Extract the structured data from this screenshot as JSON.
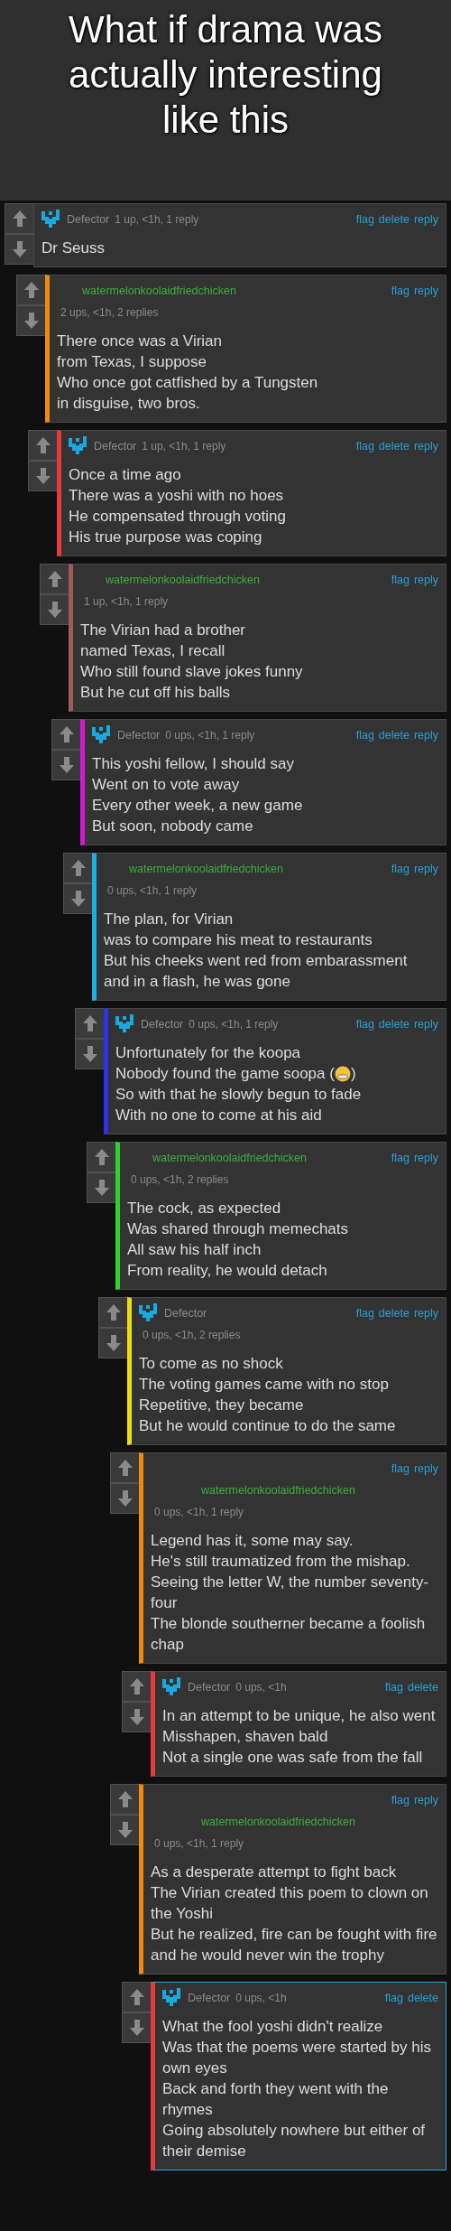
{
  "title": "What if drama was actually interesting like this",
  "comments": [
    {
      "author": "Defector",
      "avatar": true,
      "kind": "inline",
      "meta": "1 up, <1h, 1 reply",
      "actions": [
        "flag",
        "delete",
        "reply"
      ],
      "highlighted": false,
      "lines": [
        "Dr Seuss"
      ],
      "children": [
        {
          "author": "watermelonkoolaidfriedchicken",
          "avatar": false,
          "kind": "stacked",
          "meta": "2 ups, <1h, 2 replies",
          "actions": [
            "flag",
            "reply"
          ],
          "color": "#f08a0c",
          "highlighted": false,
          "lines": [
            "There once was a Virian",
            "from Texas, I suppose",
            "Who once got catfished by a Tungsten",
            "in disguise, two bros."
          ],
          "children": [
            {
              "author": "Defector",
              "avatar": true,
              "kind": "inline",
              "meta": "1 up, <1h, 1 reply",
              "actions": [
                "flag",
                "delete",
                "reply"
              ],
              "color": "#e83a3a",
              "highlighted": false,
              "lines": [
                "Once a time ago",
                "There was a yoshi with no hoes",
                "He compensated through voting",
                "His true purpose was coping"
              ],
              "children": [
                {
                  "author": "watermelonkoolaidfriedchicken",
                  "avatar": false,
                  "kind": "stacked",
                  "meta": "1 up, <1h, 1 reply",
                  "actions": [
                    "flag",
                    "reply"
                  ],
                  "color": "#a05a5a",
                  "highlighted": false,
                  "lines": [
                    "The Virian had a brother",
                    "named Texas, I recall",
                    "Who still found slave jokes funny",
                    "But he cut off his balls"
                  ],
                  "children": [
                    {
                      "author": "Defector",
                      "avatar": true,
                      "kind": "inline",
                      "meta": "0 ups, <1h, 1 reply",
                      "actions": [
                        "flag",
                        "delete",
                        "reply"
                      ],
                      "color": "#d01ad0",
                      "highlighted": false,
                      "lines": [
                        "This yoshi fellow, I should say",
                        "Went on to vote away",
                        "Every other week, a new game",
                        "But soon, nobody came"
                      ],
                      "children": [
                        {
                          "author": "watermelonkoolaidfriedchicken",
                          "avatar": false,
                          "kind": "stacked",
                          "meta": "0 ups, <1h, 1 reply",
                          "actions": [
                            "flag",
                            "reply"
                          ],
                          "color": "#1ab0e0",
                          "highlighted": false,
                          "lines": [
                            "The plan, for Virian",
                            "was to compare his meat to restaurants",
                            "But his cheeks went red from embarassment",
                            "and in a flash, he was gone"
                          ],
                          "children": [
                            {
                              "author": "Defector",
                              "avatar": true,
                              "kind": "inline",
                              "meta": "0 ups, <1h, 1 reply",
                              "actions": [
                                "flag",
                                "delete",
                                "reply"
                              ],
                              "color": "#3030f0",
                              "highlighted": false,
                              "lines": [
                                "Unfortunately for the koopa",
                                {
                                  "kind": "emoji",
                                  "text": "Nobody found the game soopa (",
                                  "tail": ")"
                                },
                                "So with that he slowly begun to fade",
                                "With no one to come at his aid"
                              ],
                              "children": [
                                {
                                  "author": "watermelonkoolaidfriedchicken",
                                  "avatar": false,
                                  "kind": "stacked",
                                  "meta": "0 ups, <1h, 2 replies",
                                  "actions": [
                                    "flag",
                                    "reply"
                                  ],
                                  "color": "#30d030",
                                  "highlighted": false,
                                  "lines": [
                                    "The cock, as expected",
                                    "Was shared through memechats",
                                    "All saw his half inch",
                                    "From reality, he would detach"
                                  ],
                                  "children": [
                                    {
                                      "author": "Defector",
                                      "avatar": true,
                                      "kind": "stacked",
                                      "meta": "0 ups, <1h, 2 replies",
                                      "actions": [
                                        "flag",
                                        "delete",
                                        "reply"
                                      ],
                                      "color": "#e8e010",
                                      "highlighted": false,
                                      "lines": [
                                        "To come as no shock",
                                        "The voting games came with no stop",
                                        "Repetitive, they became",
                                        "But he would continue to do the same"
                                      ],
                                      "children": [
                                        {
                                          "author": "watermelonkoolaidfriedchicken",
                                          "avatar": false,
                                          "kind": "tall",
                                          "meta": "0 ups, <1h, 1 reply",
                                          "actions": [
                                            "flag",
                                            "reply"
                                          ],
                                          "color": "#f08a0c",
                                          "highlighted": false,
                                          "lines": [
                                            "Legend has it, some may say.",
                                            "He's still traumatized from the mishap.",
                                            "Seeing the letter W, the number seventy-four",
                                            "The blonde southerner became a foolish chap"
                                          ],
                                          "children": [
                                            {
                                              "author": "Defector",
                                              "avatar": true,
                                              "kind": "inline",
                                              "meta": "0 ups, <1h",
                                              "actions": [
                                                "flag",
                                                "delete"
                                              ],
                                              "color": "#e83a3a",
                                              "highlighted": false,
                                              "lines": [
                                                "In an attempt to be unique, he also went",
                                                "Misshapen, shaven bald",
                                                "Not a single one was safe from the fall"
                                              ]
                                            }
                                          ]
                                        },
                                        {
                                          "author": "watermelonkoolaidfriedchicken",
                                          "avatar": false,
                                          "kind": "tall",
                                          "meta": "0 ups, <1h, 1 reply",
                                          "actions": [
                                            "flag",
                                            "reply"
                                          ],
                                          "color": "#f08a0c",
                                          "highlighted": false,
                                          "lines": [
                                            "As a desperate attempt to fight back",
                                            "The Virian created this poem to clown on the Yoshi",
                                            "But he realized, fire can be fought with fire",
                                            "and he would never win the trophy"
                                          ],
                                          "children": [
                                            {
                                              "author": "Defector",
                                              "avatar": true,
                                              "kind": "inline",
                                              "meta": "0 ups, <1h",
                                              "actions": [
                                                "flag",
                                                "delete"
                                              ],
                                              "color": "#e83a3a",
                                              "highlighted": true,
                                              "lines": [
                                                "What the fool yoshi didn't realize",
                                                "Was that the poems were started by his own eyes",
                                                "Back and forth they went with the rhymes",
                                                "Going absolutely nowhere but either of their demise"
                                              ]
                                            }
                                          ]
                                        }
                                      ]
                                    }
                                  ]
                                }
                              ]
                            }
                          ]
                        }
                      ]
                    }
                  ]
                }
              ]
            }
          ]
        }
      ]
    }
  ]
}
